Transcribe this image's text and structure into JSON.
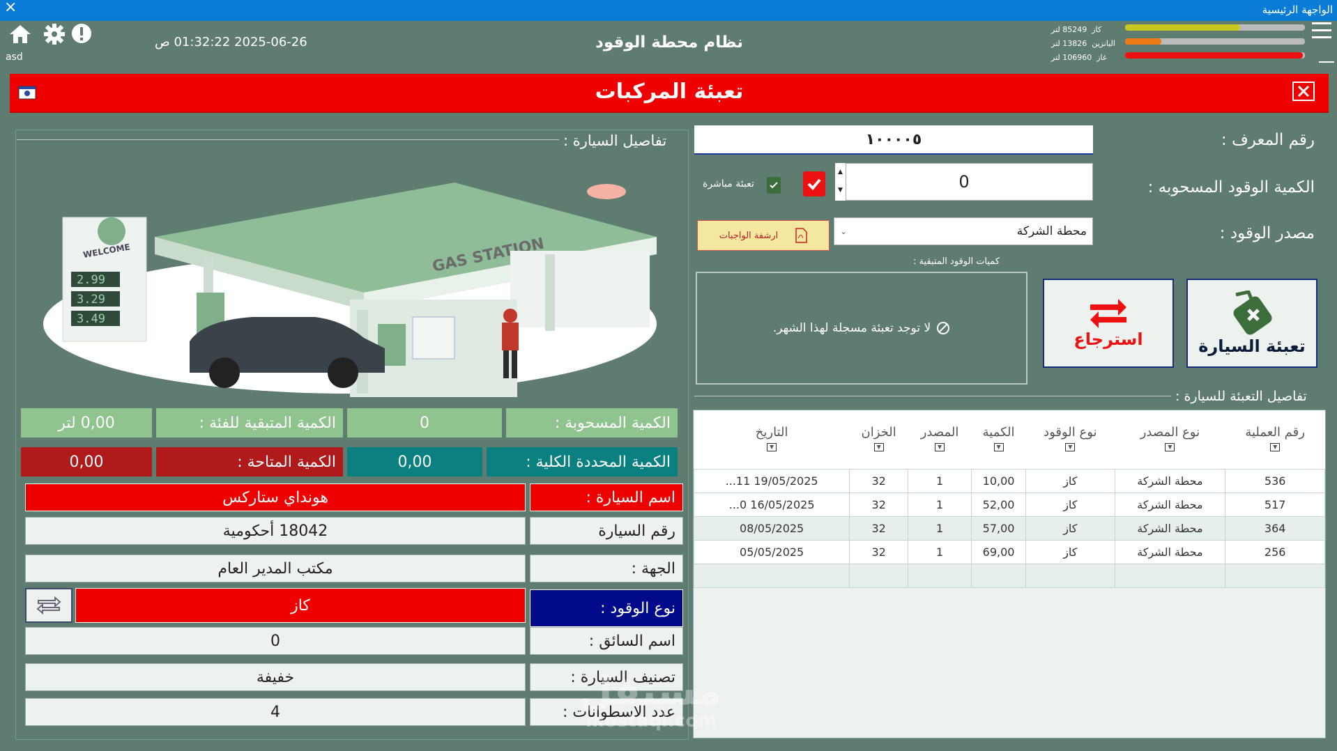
{
  "window": {
    "title": "الواجهة الرئيسية",
    "close": "×"
  },
  "header": {
    "app_title": "نظام محطة الوقود",
    "datetime": "2025-06-26 01:32:22 ص",
    "user": "asd"
  },
  "gauges": [
    {
      "fuel": "كاز",
      "amount": "85249",
      "unit": "لتر",
      "level": 0.64,
      "color": "#c8c81e"
    },
    {
      "fuel": "البانزين",
      "amount": "13826",
      "unit": "لتر",
      "level": 0.2,
      "color": "#f07a18"
    },
    {
      "fuel": "غاز",
      "amount": "106960",
      "unit": "لتر",
      "level": 0.99,
      "color": "#ee1111"
    }
  ],
  "page": {
    "title": "تعبئة المركبات",
    "close_icon": "close-icon"
  },
  "car_details": {
    "section_title": "تفاصيل السيارة :",
    "illustration": {
      "welcome": "WELCOME",
      "sign": "GAS STATION",
      "prices": [
        "2.99",
        "3.29",
        "3.49"
      ]
    },
    "stats": {
      "withdrawn_label": "الكمية المسحوبة :",
      "withdrawn_value": "0",
      "remaining_label": "الكمية المتبقية للفئة :",
      "remaining_value": "0,00 لتر",
      "total_label": "الكمية المحددة الكلية :",
      "total_value": "0,00",
      "available_label": "الكمية المتاحة :",
      "available_value": "0,00"
    },
    "rows": [
      {
        "label": "اسم السيارة :",
        "value": "هونداي ستاركس"
      },
      {
        "label": "رقم السيارة",
        "value": "18042 أحكومية"
      },
      {
        "label": "الجهة :",
        "value": "مكتب المدير العام"
      },
      {
        "label": "نوع الوقود :",
        "value": "كاز"
      },
      {
        "label": "اسم السائق :",
        "value": "0"
      },
      {
        "label": "تصنيف السيارة :",
        "value": "خفيفة"
      },
      {
        "label": "عدد الاسطوانات :",
        "value": "4"
      }
    ]
  },
  "form": {
    "id_label": "رقم المعرف :",
    "id_value": "١٠٠٠٠٥",
    "qty_label": "الكمية الوقود المسحوبه :",
    "qty_value": "0",
    "direct_label": "تعبئة مباشرة",
    "source_label": "مصدر الوقود :",
    "source_value": "محطة الشركة",
    "archive_label": "ارشفة الواجبات",
    "remaining_group": "كميات الوقود المتبقية :",
    "no_fill_msg": "لا توجد تعبئة مسجلة لهذا الشهر.",
    "fill_button": "تعبئة السيارة",
    "refund_button": "استرجاع"
  },
  "history": {
    "section_title": "تفاصيل التعبئة للسيارة :",
    "columns": [
      "رقم العملية",
      "نوع المصدر",
      "نوع الوقود",
      "الكمية",
      "المصدر",
      "الخزان",
      "التاريخ"
    ],
    "rows": [
      [
        "536",
        "محطة الشركة",
        "كاز",
        "10,00",
        "1",
        "32",
        "19/05/2025 11..."
      ],
      [
        "517",
        "محطة الشركة",
        "كاز",
        "52,00",
        "1",
        "32",
        "16/05/2025 0..."
      ],
      [
        "364",
        "محطة الشركة",
        "كاز",
        "57,00",
        "1",
        "32",
        "08/05/2025"
      ],
      [
        "256",
        "محطة الشركة",
        "كاز",
        "69,00",
        "1",
        "32",
        "05/05/2025"
      ]
    ]
  },
  "watermark": {
    "text": "مستقل",
    "sub": "mostaql.com"
  }
}
